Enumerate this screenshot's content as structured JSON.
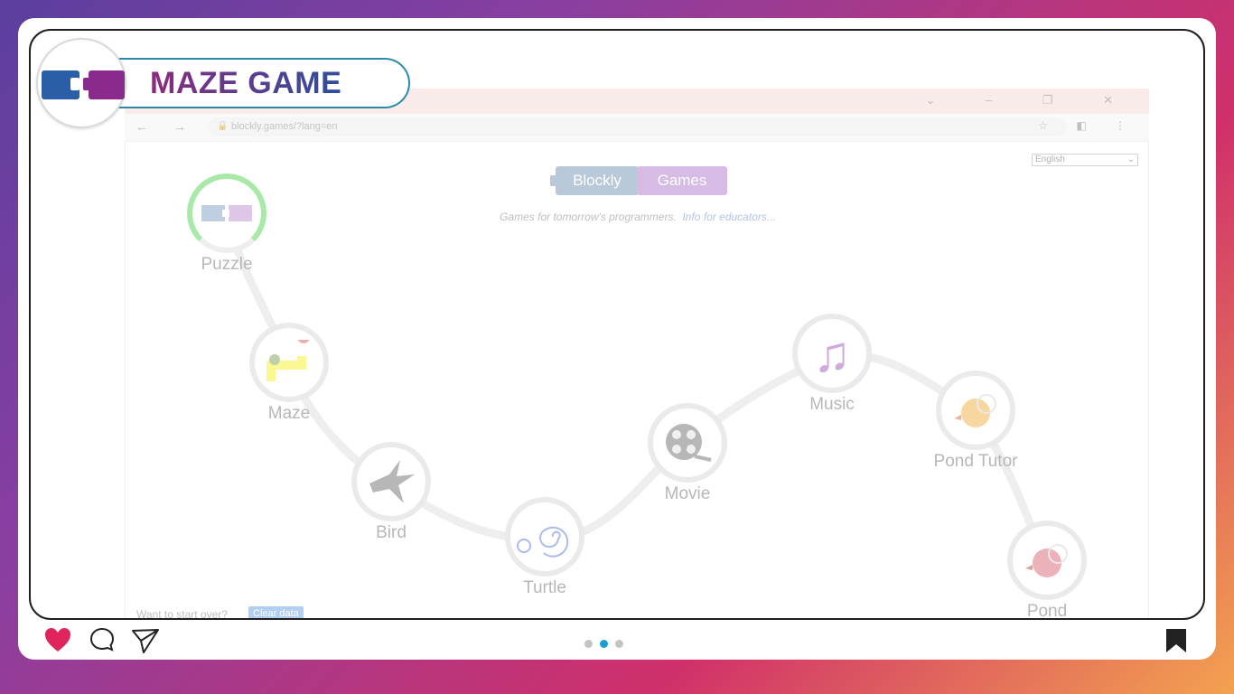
{
  "badge": {
    "title": "MAZE GAME"
  },
  "browser": {
    "url": "blockly.games/?lang=en",
    "language": "English",
    "logo_left": "Blockly",
    "logo_right": "Games",
    "tagline": "Games for tomorrow's programmers.",
    "educators_link": "Info for educators...",
    "restart_text": "Want to start over?",
    "clear_button": "Clear data"
  },
  "games": [
    {
      "label": "Puzzle",
      "icon": "puzzle-icon",
      "completed": true
    },
    {
      "label": "Maze",
      "icon": "maze-icon"
    },
    {
      "label": "Bird",
      "icon": "bird-icon"
    },
    {
      "label": "Turtle",
      "icon": "spiral-icon"
    },
    {
      "label": "Movie",
      "icon": "film-reel-icon"
    },
    {
      "label": "Music",
      "icon": "music-note-icon"
    },
    {
      "label": "Pond Tutor",
      "icon": "duck-icon"
    },
    {
      "label": "Pond",
      "icon": "pond-duck-icon"
    }
  ],
  "carousel": {
    "count": 3,
    "active": 2
  },
  "colors": {
    "accent": "#1a9fd0",
    "heart": "#e0245e",
    "title_start": "#8c2a7c",
    "title_end": "#2d4f9e"
  }
}
